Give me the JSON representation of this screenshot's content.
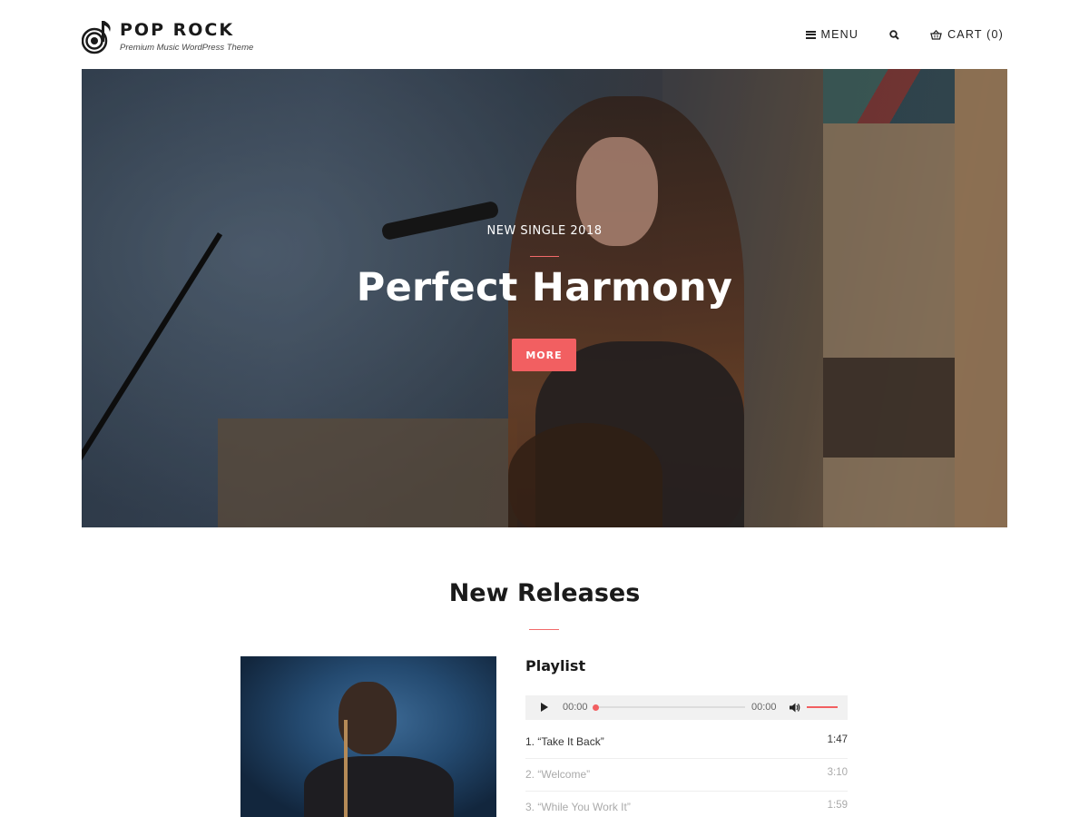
{
  "brand": {
    "title": "POP ROCK",
    "tagline": "Premium Music WordPress Theme"
  },
  "nav": {
    "menu_label": "MENU",
    "cart_label": "CART (0)"
  },
  "hero": {
    "subtitle": "NEW SINGLE 2018",
    "title": "Perfect Harmony",
    "button_label": "MORE"
  },
  "releases": {
    "section_title": "New Releases",
    "playlist_title": "Playlist",
    "player": {
      "current_time": "00:00",
      "total_time": "00:00",
      "progress": 0,
      "volume": 1.0
    },
    "tracks": [
      {
        "title": "1. “Take It Back”",
        "duration": "1:47"
      },
      {
        "title": "2. “Welcome”",
        "duration": "3:10"
      },
      {
        "title": "3. “While You Work It”",
        "duration": "1:59"
      }
    ]
  },
  "colors": {
    "accent": "#f25f61",
    "text": "#1a1a1a",
    "muted_track": "#aaaaaa"
  },
  "icons": {
    "logo": "music-note-disc-icon",
    "menu": "hamburger-icon",
    "search": "search-icon",
    "cart": "basket-icon",
    "play": "play-icon",
    "volume": "volume-icon"
  }
}
